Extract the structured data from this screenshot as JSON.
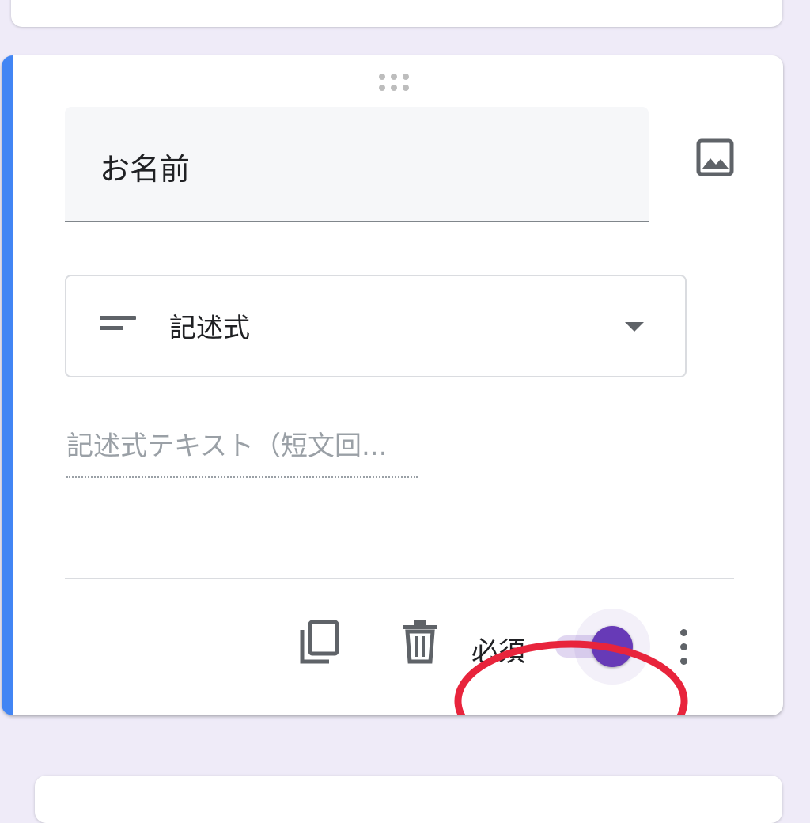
{
  "question": {
    "title": "お名前",
    "type_label": "記述式",
    "answer_placeholder": "記述式テキスト（短文回...",
    "required_label": "必須",
    "required": true
  },
  "icons": {
    "drag": "drag-handle-icon",
    "image": "image-icon",
    "type": "short-text-icon",
    "dropdown": "arrow-drop-down-icon",
    "copy": "copy-icon",
    "delete": "trash-icon",
    "more": "more-vert-icon"
  },
  "colors": {
    "accent_bar": "#4285f4",
    "toggle_on": "#673ab7",
    "toggle_track": "#e1d7f1",
    "background": "#efebf8",
    "highlight_ring": "#e8243c"
  }
}
